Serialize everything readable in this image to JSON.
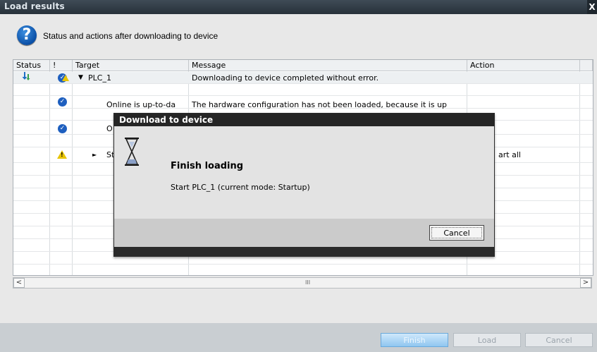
{
  "window": {
    "title": "Load results",
    "close_glyph": "X"
  },
  "header": {
    "question_glyph": "?",
    "text": "Status and actions after downloading to device"
  },
  "table": {
    "columns": [
      "Status",
      "!",
      "Target",
      "Message",
      "Action"
    ],
    "rows": [
      {
        "status_icon": "download-icon",
        "flag_icon": "check-warning-icon",
        "expander": "▼",
        "target": "PLC_1",
        "message": "Downloading to device completed without error.",
        "action": ""
      },
      {
        "status_icon": "",
        "flag_icon": "",
        "expander": "",
        "target": "",
        "message": "",
        "action": ""
      },
      {
        "status_icon": "",
        "flag_icon": "check-icon",
        "expander": "",
        "target": "Online is up-to-da",
        "message": "The hardware configuration has not been loaded, because it is up",
        "action": ""
      },
      {
        "status_icon": "",
        "flag_icon": "",
        "expander": "",
        "target": "",
        "message": "",
        "action": ""
      },
      {
        "status_icon": "",
        "flag_icon": "check-icon",
        "expander": "",
        "target": "O",
        "message": "",
        "action": ""
      },
      {
        "status_icon": "",
        "flag_icon": "",
        "expander": "",
        "target": "",
        "message": "",
        "action": ""
      },
      {
        "status_icon": "",
        "flag_icon": "warning-icon",
        "expander": "►",
        "target": "St",
        "message": "",
        "action": "art all"
      }
    ]
  },
  "scrollbar": {
    "left": "<",
    "grip": "III",
    "right": ">"
  },
  "buttons": {
    "finish": "Finish",
    "load": "Load",
    "cancel": "Cancel"
  },
  "modal": {
    "title": "Download to device",
    "heading": "Finish loading",
    "detail": "Start PLC_1 (current mode: Startup)",
    "cancel": "Cancel"
  }
}
